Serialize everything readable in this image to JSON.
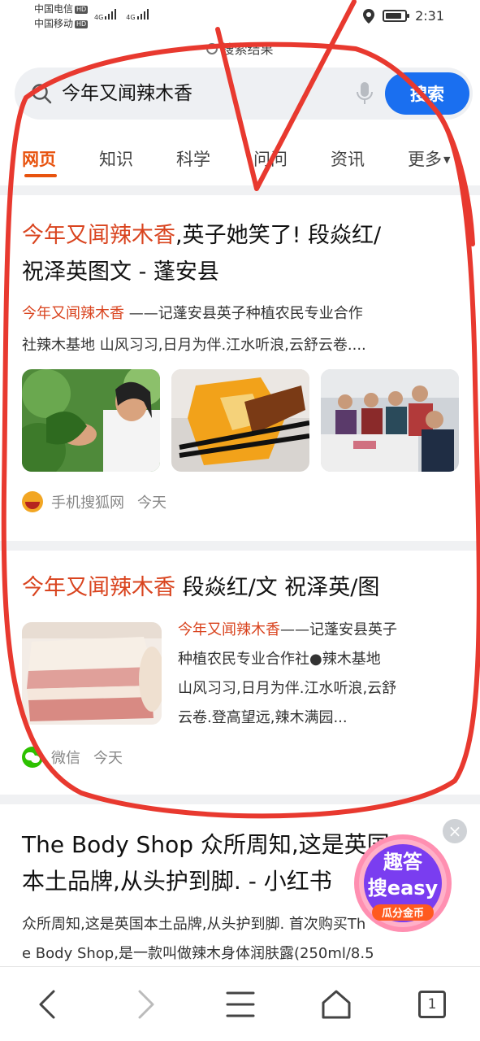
{
  "status_bar": {
    "carrier1": "中国电信",
    "carrier2": "中国移动",
    "hd_badge": "HD",
    "network1": "4G",
    "network2": "4G",
    "time": "2:31"
  },
  "page_label": "搜索结果",
  "search": {
    "query": "今年又闻辣木香",
    "button_label": "搜索"
  },
  "tabs": [
    {
      "label": "网页",
      "active": true
    },
    {
      "label": "知识",
      "active": false
    },
    {
      "label": "科学",
      "active": false
    },
    {
      "label": "问问",
      "active": false
    },
    {
      "label": "资讯",
      "active": false
    },
    {
      "label": "更多",
      "active": false
    }
  ],
  "results": [
    {
      "title_highlight": "今年又闻辣木香",
      "title_rest_line1": ",英子她笑了! 段焱红/",
      "title_line2": "祝泽英图文 - 蓬安县",
      "snippet_highlight": "今年又闻辣木香",
      "snippet_rest_line1": " ——记蓬安县英子种植农民专业合作",
      "snippet_line2": "社辣木基地 山风习习,日月为伴.江水听浪,云舒云卷....",
      "source_name": "手机搜狐网",
      "source_time": "今天"
    },
    {
      "title_highlight": "今年又闻辣木香",
      "title_rest": " 段焱红/文 祝泽英/图",
      "snippet_highlight": "今年又闻辣木香",
      "snippet_rest_line1": "——记蓬安县英子",
      "snippet_line2": "种植农民专业合作社●辣木基地",
      "snippet_line3": "山风习习,日月为伴.江水听浪,云舒",
      "snippet_line4": "云卷.登高望远,辣木满园...",
      "source_name": "微信",
      "source_time": "今天"
    },
    {
      "title_line1": "The Body Shop 众所周知,这是英国",
      "title_line2": "本土品牌,从头护到脚. - 小红书",
      "snippet_line1": "众所周知,这是英国本土品牌,从头护到脚. 首次购买Th",
      "snippet_line2": "e Body Shop,是一款叫做辣木身体润肤露(250ml/8.5"
    }
  ],
  "badge": {
    "line1": "趣答",
    "line2": "搜easy",
    "line3": "瓜分金币"
  },
  "bottom_nav": {
    "tab_count": "1"
  },
  "colors": {
    "accent_blue": "#1a6ff0",
    "highlight_red": "#d9441f",
    "tab_active": "#e8530e",
    "annotation_red": "#e8392f"
  }
}
